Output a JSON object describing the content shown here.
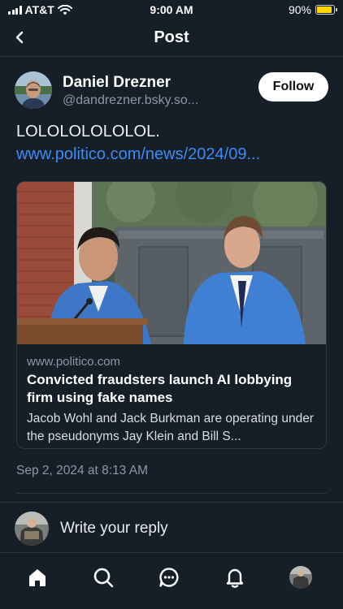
{
  "status_bar": {
    "carrier": "AT&T",
    "time": "9:00 AM",
    "battery_percent": "90%",
    "battery_level": 0.9,
    "battery_color": "#ffd60a"
  },
  "header": {
    "title": "Post",
    "back_icon": "chevron-left-icon"
  },
  "post": {
    "author_name": "Daniel Drezner",
    "author_handle": "@dandrezner.bsky.so...",
    "follow_label": "Follow",
    "text": "LOLOLOLOLOLOL.",
    "link_text": "www.politico.com/news/2024/09...",
    "link_color": "#3b8cf6",
    "timestamp": "Sep 2, 2024 at 8:13 AM"
  },
  "link_card": {
    "domain": "www.politico.com",
    "title": "Convicted fraudsters launch AI lobbying firm using fake names",
    "description": "Jacob Wohl and Jack Burkman are operating under the pseudonyms Jay Klein and Bill S..."
  },
  "reply": {
    "placeholder": "Write your reply"
  },
  "tabs": [
    {
      "name": "home",
      "icon": "home-icon"
    },
    {
      "name": "search",
      "icon": "search-icon"
    },
    {
      "name": "chat",
      "icon": "chat-icon"
    },
    {
      "name": "notifications",
      "icon": "bell-icon"
    },
    {
      "name": "profile",
      "icon": "profile-avatar"
    }
  ]
}
